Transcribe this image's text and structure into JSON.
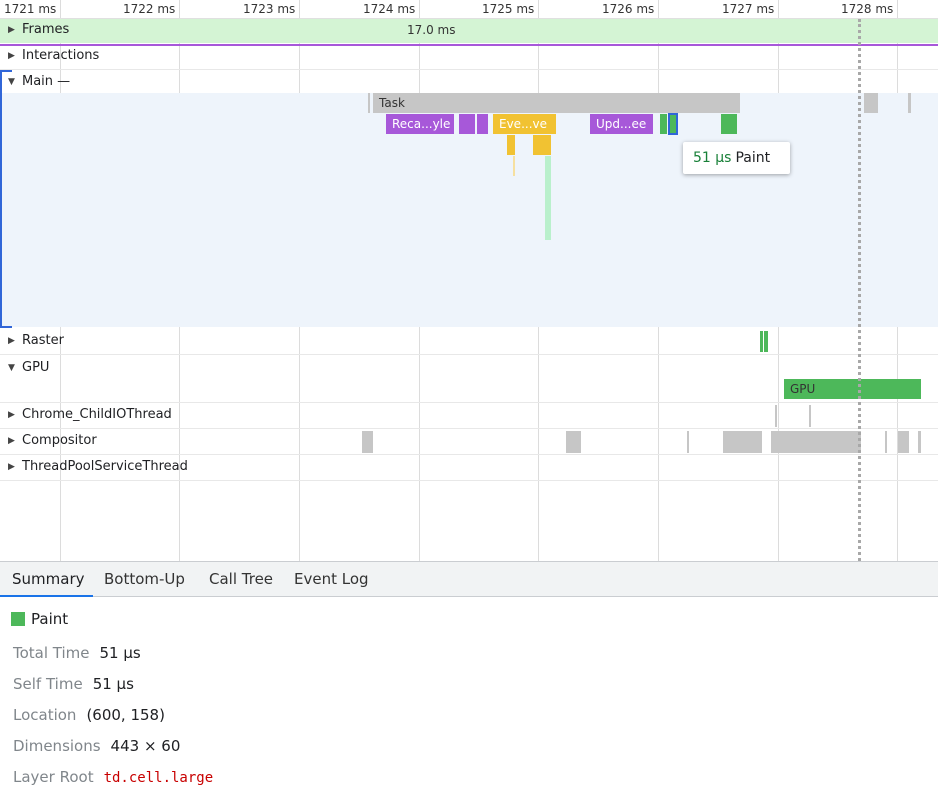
{
  "ruler": {
    "ticks": [
      "1721 ms",
      "1722 ms",
      "1723 ms",
      "1724 ms",
      "1725 ms",
      "1726 ms",
      "1727 ms",
      "1728 ms"
    ]
  },
  "frames": {
    "label": "Frames",
    "duration": "17.0 ms"
  },
  "tracks": {
    "interactions": "Interactions",
    "main": "Main —",
    "raster": "Raster",
    "gpu": "GPU",
    "childio": "Chrome_ChildIOThread",
    "compositor": "Compositor",
    "threadpool": "ThreadPoolServiceThread"
  },
  "events": {
    "task": "Task",
    "recalc": "Reca...yle",
    "event": "Eve...ve",
    "update": "Upd...ee",
    "gpu": "GPU"
  },
  "tooltip": {
    "duration": "51 µs",
    "name": "Paint"
  },
  "tabs": [
    "Summary",
    "Bottom-Up",
    "Call Tree",
    "Event Log"
  ],
  "summary": {
    "title": "Paint",
    "swatch_color": "#4db85a",
    "rows": [
      {
        "key": "Total Time",
        "value": "51 µs"
      },
      {
        "key": "Self Time",
        "value": "51 µs"
      },
      {
        "key": "Location",
        "value": "(600, 158)"
      },
      {
        "key": "Dimensions",
        "value": "443 × 60"
      },
      {
        "key": "Layer Root",
        "value": "td.cell.large"
      }
    ]
  },
  "colors": {
    "frames_bg": "#d4f4d4",
    "task": "#c6c6c6",
    "rendering": "#a758d9",
    "scripting": "#f1c232",
    "painting": "#4db85a",
    "selection": "#3166d8"
  }
}
